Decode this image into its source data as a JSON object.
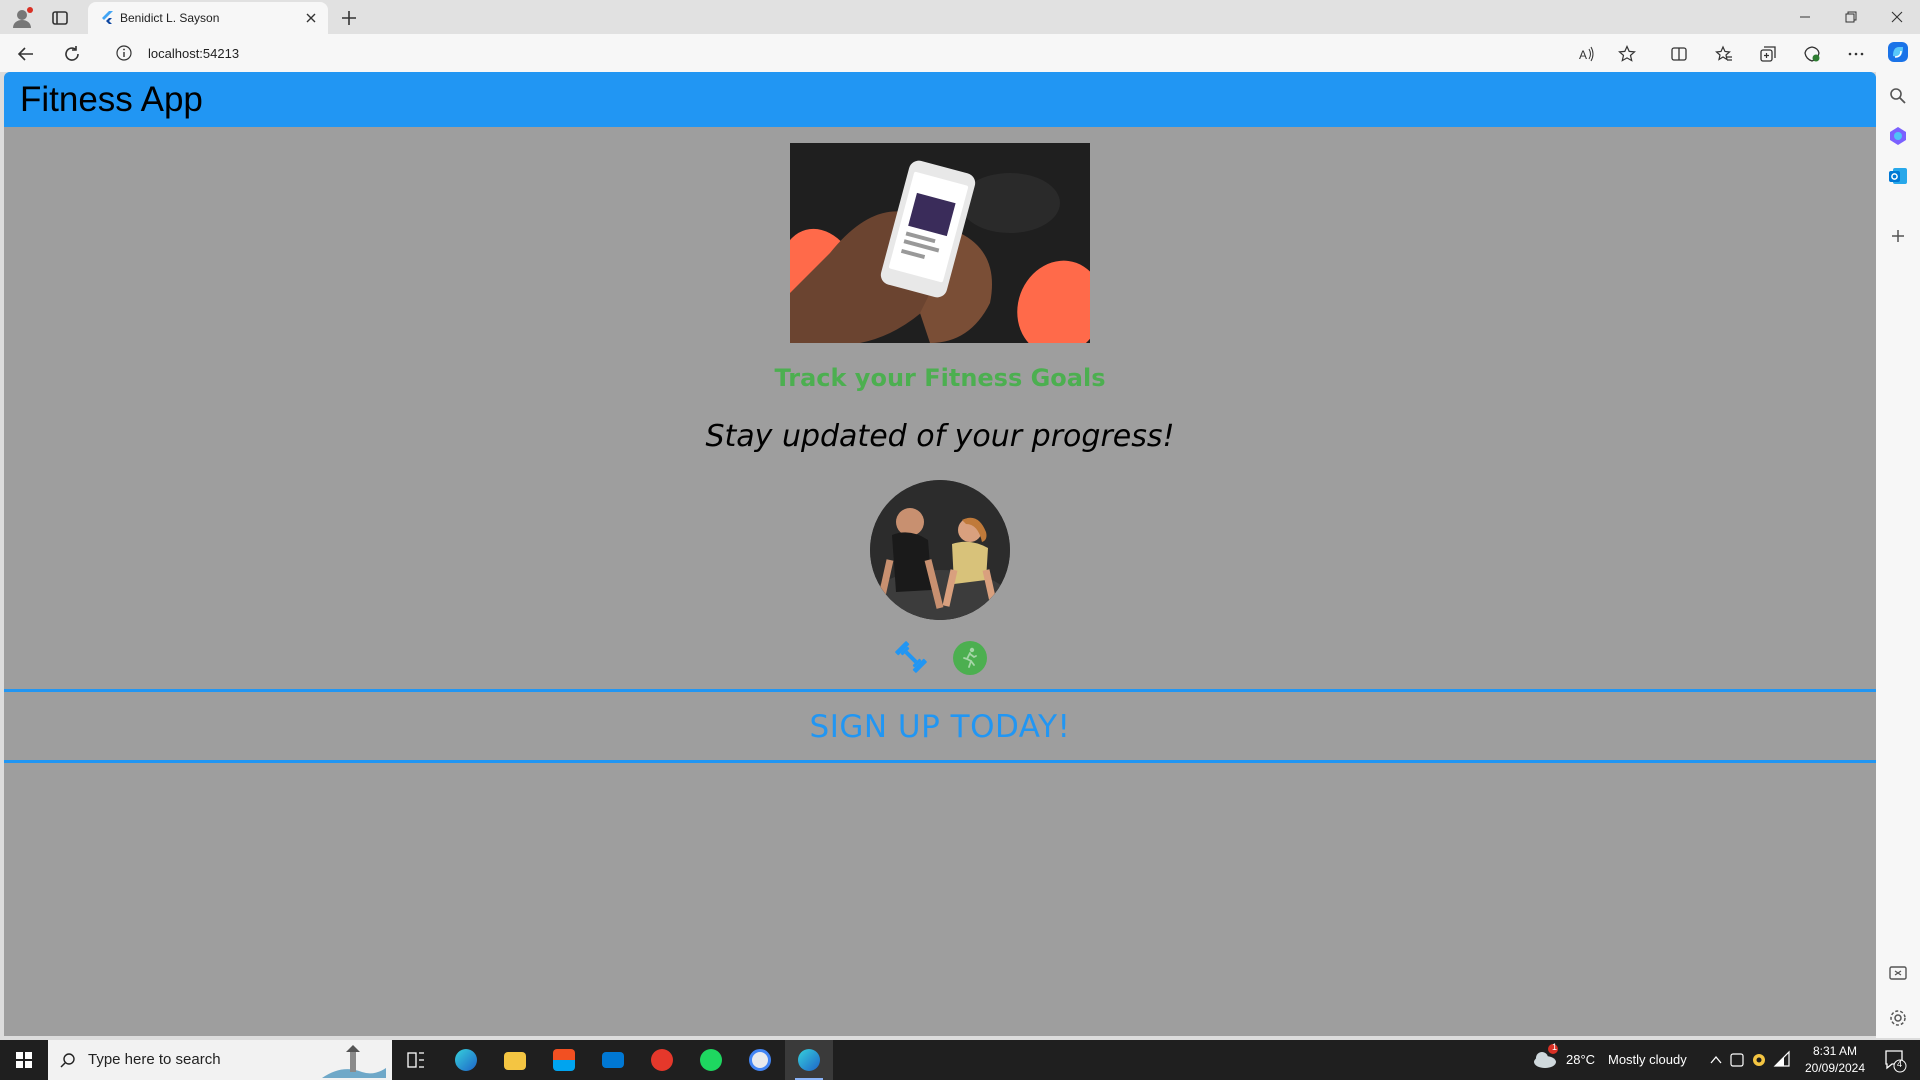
{
  "browser": {
    "tab_title": "Benidict L. Sayson",
    "url": "localhost:54213"
  },
  "app": {
    "title": "Fitness App",
    "subtitle": "Track your Fitness Goals",
    "tagline": "Stay updated of your progress!",
    "signup_label": "SIGN UP TODAY!",
    "colors": {
      "appbar": "#2196f3",
      "background": "#9e9e9e",
      "subtitle": "#4caf50",
      "accent": "#2196f3"
    },
    "icons": [
      "dumbbell-icon",
      "running-icon"
    ]
  },
  "taskbar": {
    "search_placeholder": "Type here to search",
    "weather_badge": "1",
    "weather_temp": "28°C",
    "weather_desc": "Mostly cloudy",
    "time": "8:31 AM",
    "date": "20/09/2024",
    "notification_count": "4"
  }
}
